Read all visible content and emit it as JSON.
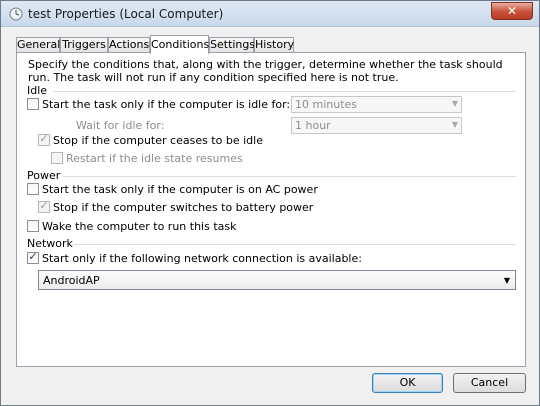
{
  "window": {
    "title": "test Properties (Local Computer)",
    "close_glyph": "✕",
    "icon": "clock-icon"
  },
  "tabs": [
    {
      "label": "General"
    },
    {
      "label": "Triggers"
    },
    {
      "label": "Actions"
    },
    {
      "label": "Conditions",
      "active": true
    },
    {
      "label": "Settings"
    },
    {
      "label": "History"
    }
  ],
  "conditions": {
    "description": "Specify the conditions that, along with the trigger, determine whether the task should run.  The task will not run  if any condition specified here is not true.",
    "idle": {
      "heading": "Idle",
      "start_only_if_idle": {
        "label": "Start the task only if the computer is idle for:",
        "checked": false
      },
      "idle_for": {
        "value": "10 minutes"
      },
      "wait_for_idle": {
        "label": "Wait for idle for:",
        "value": "1 hour"
      },
      "stop_if_ceases": {
        "label": "Stop if the computer ceases to be idle",
        "checked": true
      },
      "restart_if_resumes": {
        "label": "Restart if the idle state resumes",
        "checked": false
      }
    },
    "power": {
      "heading": "Power",
      "ac_power": {
        "label": "Start the task only if the computer is on AC power",
        "checked": false
      },
      "battery": {
        "label": "Stop if the computer switches to battery power",
        "checked": true
      },
      "wake": {
        "label": "Wake the computer to run this task",
        "checked": false
      }
    },
    "network": {
      "heading": "Network",
      "start_if_network": {
        "label": "Start only if the following network connection is available:",
        "checked": true
      },
      "connection": {
        "value": "AndroidAP"
      }
    }
  },
  "buttons": {
    "ok": "OK",
    "cancel": "Cancel"
  },
  "glyphs": {
    "check": "✓",
    "dropdown": "▼"
  }
}
